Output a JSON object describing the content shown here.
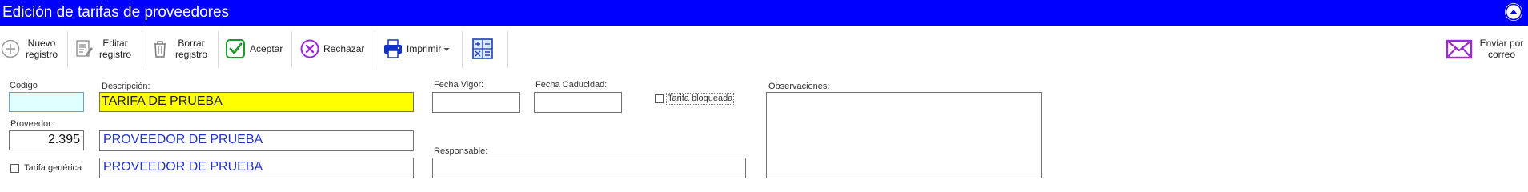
{
  "window": {
    "title": "Edición de tarifas de proveedores"
  },
  "toolbar": {
    "nuevo_line1": "Nuevo",
    "nuevo_line2": "registro",
    "editar_line1": "Editar",
    "editar_line2": "registro",
    "borrar_line1": "Borrar",
    "borrar_line2": "registro",
    "aceptar": "Aceptar",
    "rechazar": "Rechazar",
    "imprimir": "Imprimir",
    "enviar_line1": "Enviar por",
    "enviar_line2": "correo"
  },
  "form": {
    "codigo": {
      "label": "Código",
      "value": ""
    },
    "descripcion": {
      "label": "Descripción:",
      "value": "TARIFA DE PRUEBA"
    },
    "fecha_vigor": {
      "label": "Fecha Vigor:",
      "value": ""
    },
    "fecha_caducidad": {
      "label": "Fecha Caducidad:",
      "value": ""
    },
    "tarifa_bloqueada": {
      "label": "Tarifa bloqueada",
      "checked": false
    },
    "observaciones": {
      "label": "Observaciones:",
      "value": ""
    },
    "proveedor": {
      "label": "Proveedor:",
      "code": "2.395",
      "name": "PROVEEDOR DE PRUEBA"
    },
    "responsable": {
      "label": "Responsable:",
      "value": ""
    },
    "tarifa_generica": {
      "label": "Tarifa genérica",
      "checked": false,
      "name": "PROVEEDOR DE PRUEBA"
    }
  },
  "colors": {
    "titlebar": "#0000ff",
    "highlight_field": "#ffff00",
    "code_field": "#e0ffff",
    "value_text": "#2234c8",
    "accept_green": "#1a9a2a",
    "purple_icons": "#9b2bd6",
    "print_blue": "#1030c8"
  }
}
